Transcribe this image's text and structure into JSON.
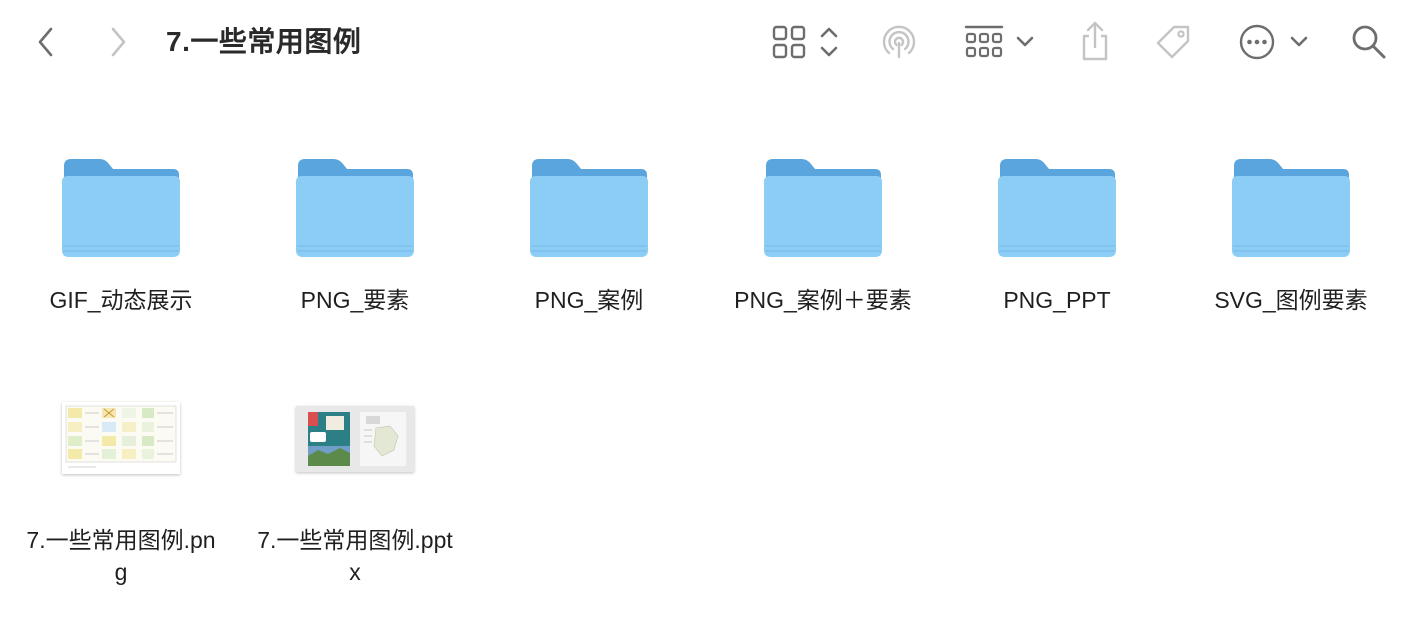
{
  "window": {
    "title": "7.一些常用图例"
  },
  "toolbar": {
    "back": "back-icon",
    "forward": "forward-icon",
    "view": "icon-grid-view-icon",
    "airdrop": "airdrop-icon",
    "group": "group-by-icon",
    "share": "share-icon",
    "tags": "tag-icon",
    "more": "more-actions-icon",
    "search": "search-icon"
  },
  "colors": {
    "folder_front": "#8ccdf6",
    "folder_back": "#5aa5dd",
    "icon_gray": "#6d6d6d",
    "icon_disabled": "#c4c4c4"
  },
  "items": [
    {
      "name": "GIF_动态展示",
      "kind": "folder"
    },
    {
      "name": "PNG_要素",
      "kind": "folder"
    },
    {
      "name": "PNG_案例",
      "kind": "folder"
    },
    {
      "name": "PNG_案例＋要素",
      "kind": "folder"
    },
    {
      "name": "PNG_PPT",
      "kind": "folder"
    },
    {
      "name": "SVG_图例要素",
      "kind": "folder"
    },
    {
      "name": "7.一些常用图例.png",
      "kind": "png"
    },
    {
      "name": "7.一些常用图例.pptx",
      "kind": "pptx"
    }
  ]
}
